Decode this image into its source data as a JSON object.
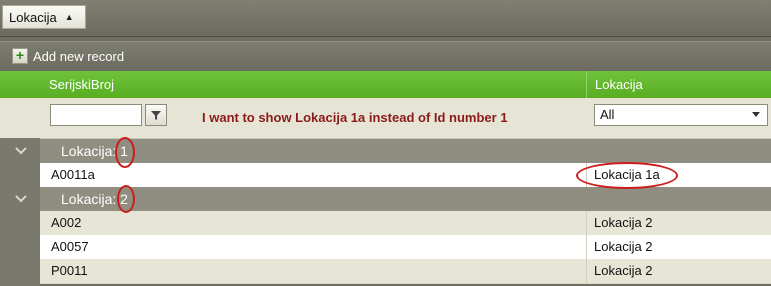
{
  "group_panel": {
    "chip_label": "Lokacija"
  },
  "command_bar": {
    "add_label": "Add new record"
  },
  "columns": [
    "SerijskiBroj",
    "Lokacija"
  ],
  "filter": {
    "text_value": "",
    "select_value": "All",
    "annotation": "I want to show Lokacija 1a instead of Id number 1"
  },
  "groups": [
    {
      "label": "Lokacija: 1",
      "rows": [
        {
          "serijski": "A0011a",
          "lokacija": "Lokacija 1a"
        }
      ]
    },
    {
      "label": "Lokacija: 2",
      "rows": [
        {
          "serijski": "A002",
          "lokacija": "Lokacija 2"
        },
        {
          "serijski": "A0057",
          "lokacija": "Lokacija 2"
        },
        {
          "serijski": "P0011",
          "lokacija": "Lokacija 2"
        }
      ]
    }
  ],
  "colors": {
    "header_green": "#62b82e",
    "annotation_red": "#cc1c1c"
  },
  "icons": [
    "sort-ascending-icon",
    "plus-icon",
    "filter-funnel-icon",
    "dropdown-arrow-icon",
    "collapse-chevron-icon"
  ]
}
